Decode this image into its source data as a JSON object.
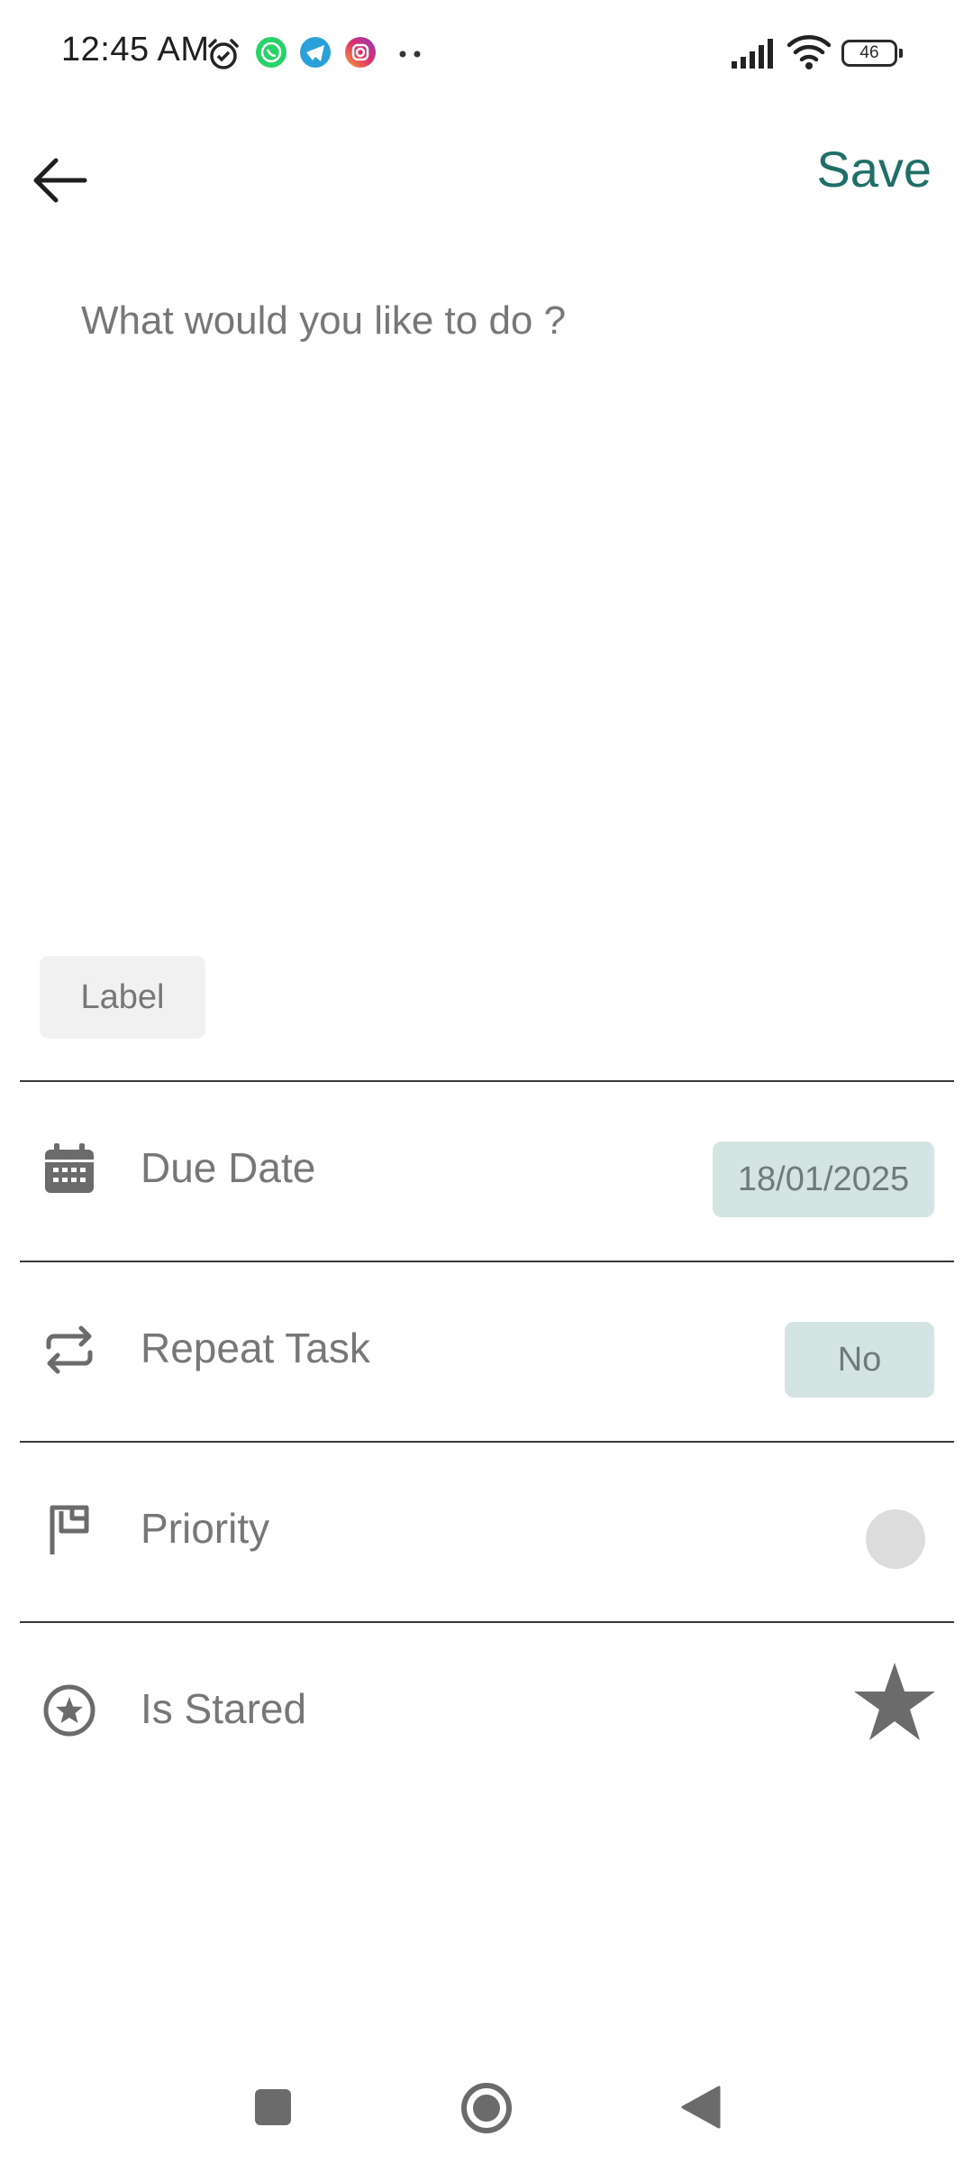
{
  "status_bar": {
    "time": "12:45 AM",
    "battery": "46",
    "icons": [
      "alarm-icon",
      "whatsapp-icon",
      "telegram-icon",
      "instagram-icon",
      "more-dots-icon",
      "signal-icon",
      "wifi-icon",
      "battery-icon"
    ]
  },
  "header": {
    "back_icon": "arrow-left-icon",
    "save_label": "Save"
  },
  "task": {
    "placeholder": "What would you like to do ?",
    "value": ""
  },
  "label_chip": "Label",
  "options": {
    "due_date": {
      "label": "Due Date",
      "value": "18/01/2025",
      "icon": "calendar-icon"
    },
    "repeat": {
      "label": "Repeat Task",
      "value": "No",
      "icon": "repeat-icon"
    },
    "priority": {
      "label": "Priority",
      "icon": "flag-icon",
      "enabled": false
    },
    "starred": {
      "label": "Is Stared",
      "icon": "star-circle-icon",
      "starred": true
    }
  },
  "colors": {
    "accent": "#1f6f68",
    "pill_bg": "#d3e4e3",
    "muted_text": "#777777",
    "divider": "#3a3a3a"
  },
  "nav": [
    "recents-square-icon",
    "home-circle-icon",
    "back-triangle-icon"
  ]
}
